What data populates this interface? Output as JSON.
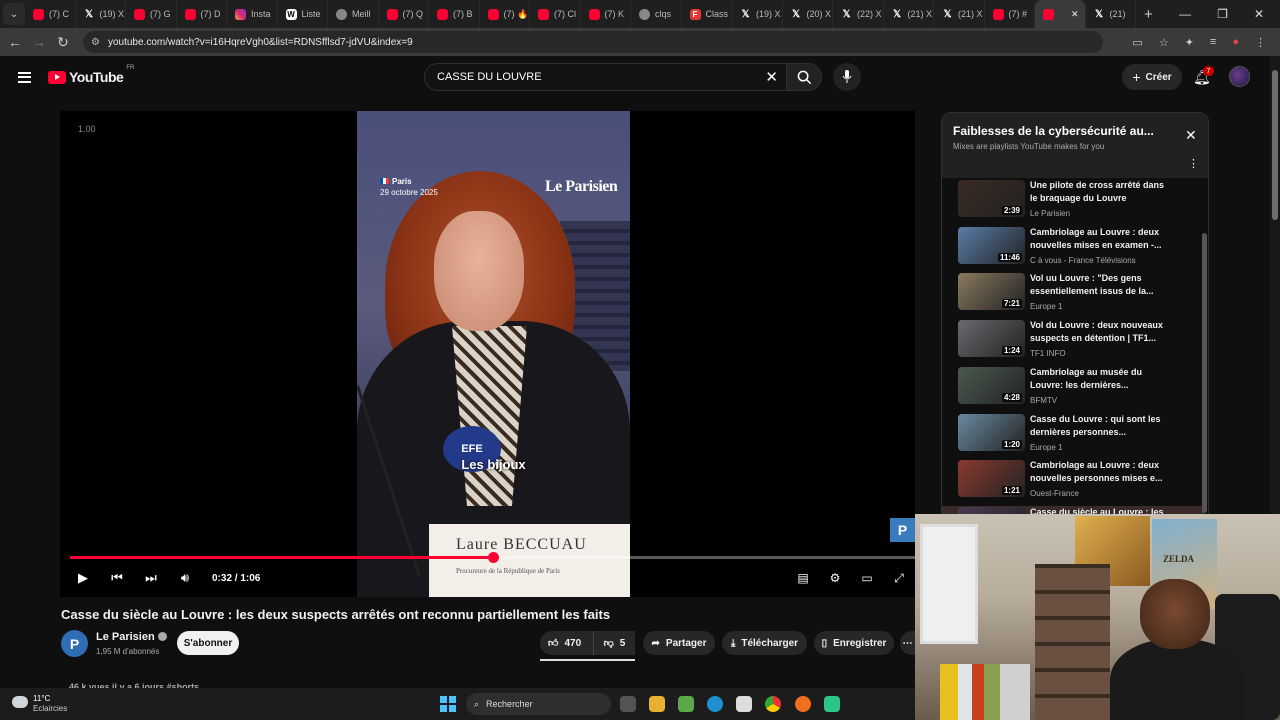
{
  "browser": {
    "tabs": [
      {
        "label": "(7) C",
        "icon": "youtube-icon"
      },
      {
        "label": "(19) X",
        "icon": "x-icon"
      },
      {
        "label": "(7) G",
        "icon": "youtube-icon"
      },
      {
        "label": "(7) D",
        "icon": "youtube-icon"
      },
      {
        "label": "Insta",
        "icon": "instagram-icon"
      },
      {
        "label": "Liste",
        "icon": "wikipedia-icon"
      },
      {
        "label": "Meill",
        "icon": "globe-icon"
      },
      {
        "label": "(7) Q",
        "icon": "youtube-icon"
      },
      {
        "label": "(7) B",
        "icon": "youtube-icon"
      },
      {
        "label": "(7) 🔥",
        "icon": "youtube-icon"
      },
      {
        "label": "(7) Cl",
        "icon": "youtube-icon"
      },
      {
        "label": "(7) K",
        "icon": "youtube-icon"
      },
      {
        "label": "clqs",
        "icon": "globe-icon"
      },
      {
        "label": "Class",
        "icon": "f-icon"
      },
      {
        "label": "(19) X",
        "icon": "x-icon"
      },
      {
        "label": "(20) X",
        "icon": "x-icon"
      },
      {
        "label": "(22) X",
        "icon": "x-icon"
      },
      {
        "label": "(21) X",
        "icon": "x-icon"
      },
      {
        "label": "(21) X",
        "icon": "x-icon"
      },
      {
        "label": "(7) #",
        "icon": "youtube-icon"
      },
      {
        "label": "",
        "icon": "youtube-icon",
        "active": true
      },
      {
        "label": "(21)",
        "icon": "x-icon"
      }
    ],
    "url": "youtube.com/watch?v=i16HqreVgh0&list=RDNSfflsd7-jdVU&index=9"
  },
  "header": {
    "logo_text": "YouTube",
    "country": "FR",
    "search_value": "CASSE DU LOUVRE",
    "create_label": "Créer",
    "notifications": "7"
  },
  "player": {
    "speed": "1.00",
    "location": "Paris",
    "date": "29 octobre 2025",
    "brand": "Le Parisien",
    "subtitle": "Les bijoux",
    "mic_label": "EFE",
    "placard_name": "Laure BECCUAU",
    "placard_title": "Procureure de la République de Paris",
    "time": "0:32 / 1:06",
    "progress_fraction": 0.5,
    "ad_badge": "P"
  },
  "video": {
    "title": "Casse du siècle au Louvre : les deux suspects arrêtés ont reconnu partiellement les faits",
    "channel_initial": "P",
    "channel": "Le Parisien",
    "subscribers": "1,95 M d'abonnés",
    "subscribe_label": "S'abonner",
    "likes": "470",
    "dislikes": "5",
    "share_label": "Partager",
    "download_label": "Télécharger",
    "save_label": "Enregistrer",
    "meta": "46 k vues  il y a 6 jours  #shorts"
  },
  "playlist": {
    "title": "Faiblesses de la cybersécurité au...",
    "subtitle": "Mixes are playlists YouTube makes for you",
    "items": [
      {
        "title": "Une pilote de cross arrêté dans le braquage du Louvre",
        "channel": "Le Parisien",
        "duration": "2:39"
      },
      {
        "title": "Cambriolage au Louvre : deux nouvelles mises en examen -...",
        "channel": "C à vous - France Télévisions",
        "duration": "11:46"
      },
      {
        "title": "Vol uu Louvre : \"Des gens essentiellement issus de la...",
        "channel": "Europe 1",
        "duration": "7:21"
      },
      {
        "title": "Vol du Louvre : deux nouveaux suspects en détention | TF1...",
        "channel": "TF1 INFO",
        "duration": "1:24"
      },
      {
        "title": "Cambriolage au musée du Louvre: les dernières...",
        "channel": "BFMTV",
        "duration": "4:28"
      },
      {
        "title": "Casse du Louvre : qui sont les dernières personnes...",
        "channel": "Europe 1",
        "duration": "1:20"
      },
      {
        "title": "Cambriolage au Louvre : deux nouvelles personnes mises e...",
        "channel": "Ouest-France",
        "duration": "1:21"
      },
      {
        "title": "Casse du siècle au Louvre : les",
        "channel": "",
        "duration": "",
        "current": true
      }
    ]
  },
  "webcam": {
    "poster_text": "ZELDA"
  },
  "taskbar": {
    "temperature": "11°C",
    "weather": "Eclaircies",
    "search_placeholder": "Rechercher"
  }
}
